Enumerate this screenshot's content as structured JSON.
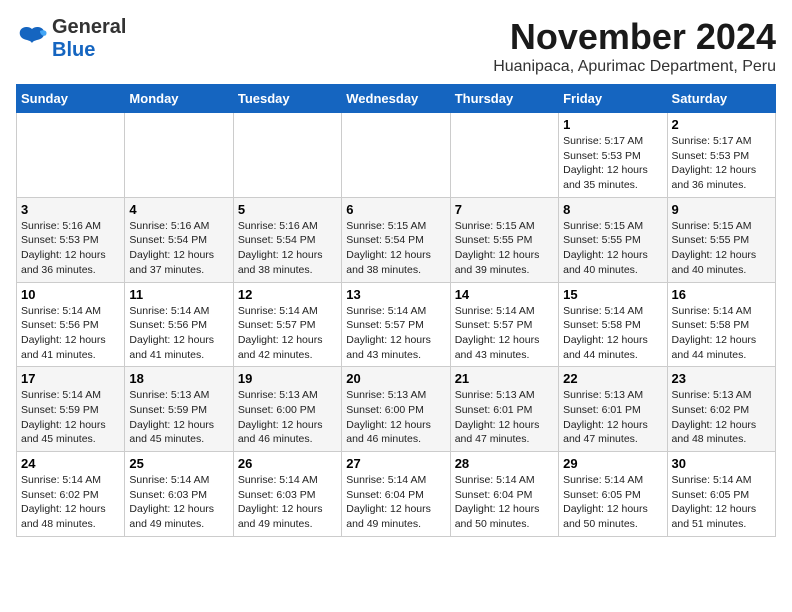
{
  "logo": {
    "general": "General",
    "blue": "Blue"
  },
  "title": "November 2024",
  "subtitle": "Huanipaca, Apurimac Department, Peru",
  "weekdays": [
    "Sunday",
    "Monday",
    "Tuesday",
    "Wednesday",
    "Thursday",
    "Friday",
    "Saturday"
  ],
  "weeks": [
    [
      {
        "day": "",
        "info": ""
      },
      {
        "day": "",
        "info": ""
      },
      {
        "day": "",
        "info": ""
      },
      {
        "day": "",
        "info": ""
      },
      {
        "day": "",
        "info": ""
      },
      {
        "day": "1",
        "info": "Sunrise: 5:17 AM\nSunset: 5:53 PM\nDaylight: 12 hours\nand 35 minutes."
      },
      {
        "day": "2",
        "info": "Sunrise: 5:17 AM\nSunset: 5:53 PM\nDaylight: 12 hours\nand 36 minutes."
      }
    ],
    [
      {
        "day": "3",
        "info": "Sunrise: 5:16 AM\nSunset: 5:53 PM\nDaylight: 12 hours\nand 36 minutes."
      },
      {
        "day": "4",
        "info": "Sunrise: 5:16 AM\nSunset: 5:54 PM\nDaylight: 12 hours\nand 37 minutes."
      },
      {
        "day": "5",
        "info": "Sunrise: 5:16 AM\nSunset: 5:54 PM\nDaylight: 12 hours\nand 38 minutes."
      },
      {
        "day": "6",
        "info": "Sunrise: 5:15 AM\nSunset: 5:54 PM\nDaylight: 12 hours\nand 38 minutes."
      },
      {
        "day": "7",
        "info": "Sunrise: 5:15 AM\nSunset: 5:55 PM\nDaylight: 12 hours\nand 39 minutes."
      },
      {
        "day": "8",
        "info": "Sunrise: 5:15 AM\nSunset: 5:55 PM\nDaylight: 12 hours\nand 40 minutes."
      },
      {
        "day": "9",
        "info": "Sunrise: 5:15 AM\nSunset: 5:55 PM\nDaylight: 12 hours\nand 40 minutes."
      }
    ],
    [
      {
        "day": "10",
        "info": "Sunrise: 5:14 AM\nSunset: 5:56 PM\nDaylight: 12 hours\nand 41 minutes."
      },
      {
        "day": "11",
        "info": "Sunrise: 5:14 AM\nSunset: 5:56 PM\nDaylight: 12 hours\nand 41 minutes."
      },
      {
        "day": "12",
        "info": "Sunrise: 5:14 AM\nSunset: 5:57 PM\nDaylight: 12 hours\nand 42 minutes."
      },
      {
        "day": "13",
        "info": "Sunrise: 5:14 AM\nSunset: 5:57 PM\nDaylight: 12 hours\nand 43 minutes."
      },
      {
        "day": "14",
        "info": "Sunrise: 5:14 AM\nSunset: 5:57 PM\nDaylight: 12 hours\nand 43 minutes."
      },
      {
        "day": "15",
        "info": "Sunrise: 5:14 AM\nSunset: 5:58 PM\nDaylight: 12 hours\nand 44 minutes."
      },
      {
        "day": "16",
        "info": "Sunrise: 5:14 AM\nSunset: 5:58 PM\nDaylight: 12 hours\nand 44 minutes."
      }
    ],
    [
      {
        "day": "17",
        "info": "Sunrise: 5:14 AM\nSunset: 5:59 PM\nDaylight: 12 hours\nand 45 minutes."
      },
      {
        "day": "18",
        "info": "Sunrise: 5:13 AM\nSunset: 5:59 PM\nDaylight: 12 hours\nand 45 minutes."
      },
      {
        "day": "19",
        "info": "Sunrise: 5:13 AM\nSunset: 6:00 PM\nDaylight: 12 hours\nand 46 minutes."
      },
      {
        "day": "20",
        "info": "Sunrise: 5:13 AM\nSunset: 6:00 PM\nDaylight: 12 hours\nand 46 minutes."
      },
      {
        "day": "21",
        "info": "Sunrise: 5:13 AM\nSunset: 6:01 PM\nDaylight: 12 hours\nand 47 minutes."
      },
      {
        "day": "22",
        "info": "Sunrise: 5:13 AM\nSunset: 6:01 PM\nDaylight: 12 hours\nand 47 minutes."
      },
      {
        "day": "23",
        "info": "Sunrise: 5:13 AM\nSunset: 6:02 PM\nDaylight: 12 hours\nand 48 minutes."
      }
    ],
    [
      {
        "day": "24",
        "info": "Sunrise: 5:14 AM\nSunset: 6:02 PM\nDaylight: 12 hours\nand 48 minutes."
      },
      {
        "day": "25",
        "info": "Sunrise: 5:14 AM\nSunset: 6:03 PM\nDaylight: 12 hours\nand 49 minutes."
      },
      {
        "day": "26",
        "info": "Sunrise: 5:14 AM\nSunset: 6:03 PM\nDaylight: 12 hours\nand 49 minutes."
      },
      {
        "day": "27",
        "info": "Sunrise: 5:14 AM\nSunset: 6:04 PM\nDaylight: 12 hours\nand 49 minutes."
      },
      {
        "day": "28",
        "info": "Sunrise: 5:14 AM\nSunset: 6:04 PM\nDaylight: 12 hours\nand 50 minutes."
      },
      {
        "day": "29",
        "info": "Sunrise: 5:14 AM\nSunset: 6:05 PM\nDaylight: 12 hours\nand 50 minutes."
      },
      {
        "day": "30",
        "info": "Sunrise: 5:14 AM\nSunset: 6:05 PM\nDaylight: 12 hours\nand 51 minutes."
      }
    ]
  ]
}
